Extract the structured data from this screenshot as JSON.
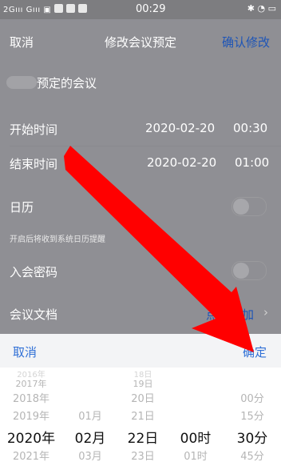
{
  "status": {
    "left": "2Gııı Gııı ▣",
    "time": "00:29",
    "right": "✱ ◔ ▭"
  },
  "nav": {
    "cancel": "取消",
    "title": "修改会议预定",
    "confirm": "确认修改"
  },
  "meeting": {
    "label": "预定的会议"
  },
  "start": {
    "label": "开始时间",
    "date": "2020-02-20",
    "time": "00:30"
  },
  "end": {
    "label": "结束时间",
    "date": "2020-02-20",
    "time": "01:00"
  },
  "calendar": {
    "label": "日历",
    "hint": "开启后将收到系统日历提醒"
  },
  "password": {
    "label": "入会密码"
  },
  "docs": {
    "label": "会议文档",
    "action": "点击添加"
  },
  "sheet": {
    "cancel": "取消",
    "ok": "确定"
  },
  "picker": {
    "years": [
      "2016年",
      "2017年",
      "2018年",
      "2019年",
      "2020年",
      "2021年"
    ],
    "months": [
      "",
      "",
      "",
      "01月",
      "02月",
      "03月"
    ],
    "days": [
      "18日",
      "19日",
      "20日",
      "21日",
      "22日",
      "23日"
    ],
    "hours": [
      "",
      "",
      "",
      "",
      "00时",
      "01时"
    ],
    "minutes": [
      "",
      "",
      "00分",
      "15分",
      "30分",
      "45分"
    ]
  },
  "colors": {
    "accent": "#2f6fd6",
    "overlay": "#8f8f94",
    "arrow": "#ff0000"
  }
}
